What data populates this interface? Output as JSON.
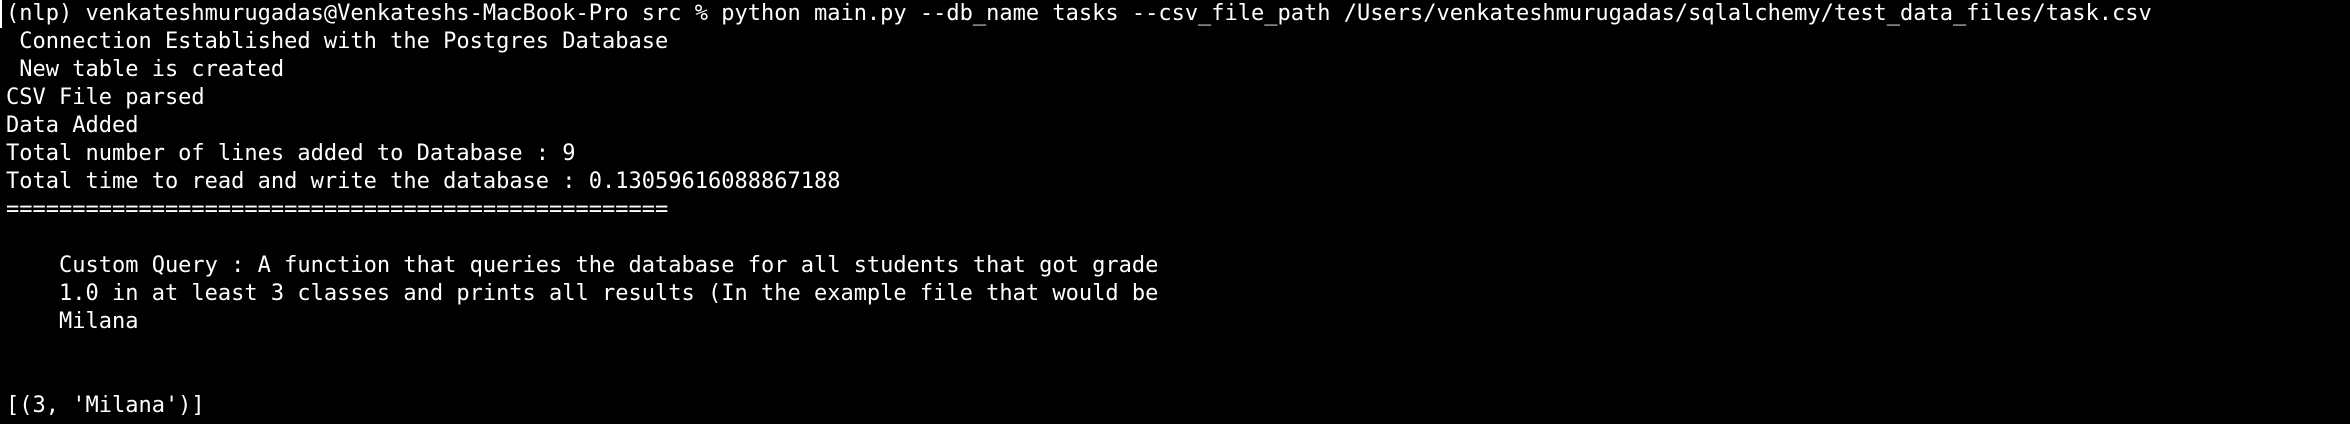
{
  "terminal": {
    "lines": [
      "(nlp) venkateshmurugadas@Venkateshs-MacBook-Pro src % python main.py --db_name tasks --csv_file_path /Users/venkateshmurugadas/sqlalchemy/test_data_files/task.csv",
      " Connection Established with the Postgres Database",
      " New table is created",
      "CSV File parsed",
      "Data Added",
      "Total number of lines added to Database : 9",
      "Total time to read and write the database : 0.13059616088867188",
      "==================================================",
      "",
      "    Custom Query : A function that queries the database for all students that got grade",
      "    1.0 in at least 3 classes and prints all results (In the example file that would be",
      "    Milana",
      "",
      "",
      "[(3, 'Milana')]"
    ]
  }
}
